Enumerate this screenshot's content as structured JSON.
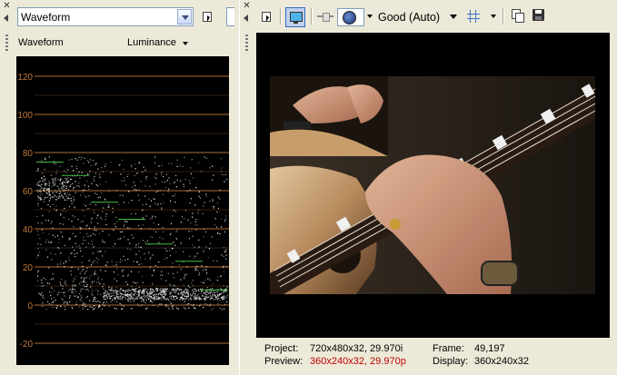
{
  "left_panel": {
    "scope_selector": {
      "value": "Waveform"
    },
    "header": {
      "title": "Waveform",
      "mode": "Luminance"
    },
    "scope": {
      "y_ticks": [
        "120",
        "100",
        "80",
        "60",
        "40",
        "20",
        "0",
        "-20"
      ],
      "y_values": [
        120,
        100,
        80,
        60,
        40,
        20,
        0,
        -20
      ]
    }
  },
  "right_panel": {
    "toolbar": {
      "quality_label": "Good (Auto)"
    },
    "status": {
      "project_label": "Project:",
      "project_value": "720x480x32, 29.970i",
      "preview_label": "Preview:",
      "preview_value": "360x240x32, 29.970p",
      "frame_label": "Frame:",
      "frame_value": "49,197",
      "display_label": "Display:",
      "display_value": "360x240x32"
    }
  },
  "colors": {
    "graticule": "#c07a3a",
    "scope_background": "#000000",
    "preview_status_red": "#c00000",
    "highlight_blue": "#316ac5"
  }
}
